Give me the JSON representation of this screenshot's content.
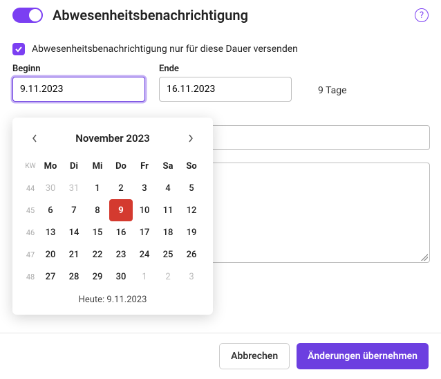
{
  "header": {
    "title": "Abwesenheitsbenachrichtigung"
  },
  "checkbox": {
    "label": "Abwesenheitsbenachrichtigung nur für diese Dauer versenden",
    "checked": true
  },
  "fields": {
    "start_label": "Beginn",
    "start_value": "9.11.2023",
    "end_label": "Ende",
    "end_value": "16.11.2023",
    "duration": "9 Tage"
  },
  "datepicker": {
    "month_year": "November 2023",
    "kw_label": "KW",
    "weekdays": [
      "Mo",
      "Di",
      "Mi",
      "Do",
      "Fr",
      "Sa",
      "So"
    ],
    "weeks": [
      {
        "wk": "44",
        "days": [
          {
            "d": "30",
            "out": true
          },
          {
            "d": "31",
            "out": true
          },
          {
            "d": "1"
          },
          {
            "d": "2"
          },
          {
            "d": "3"
          },
          {
            "d": "4"
          },
          {
            "d": "5"
          }
        ]
      },
      {
        "wk": "45",
        "days": [
          {
            "d": "6"
          },
          {
            "d": "7"
          },
          {
            "d": "8"
          },
          {
            "d": "9",
            "selected": true
          },
          {
            "d": "10"
          },
          {
            "d": "11"
          },
          {
            "d": "12"
          }
        ]
      },
      {
        "wk": "46",
        "days": [
          {
            "d": "13"
          },
          {
            "d": "14"
          },
          {
            "d": "15"
          },
          {
            "d": "16"
          },
          {
            "d": "17"
          },
          {
            "d": "18"
          },
          {
            "d": "19"
          }
        ]
      },
      {
        "wk": "47",
        "days": [
          {
            "d": "20"
          },
          {
            "d": "21"
          },
          {
            "d": "22"
          },
          {
            "d": "23"
          },
          {
            "d": "24"
          },
          {
            "d": "25"
          },
          {
            "d": "26"
          }
        ]
      },
      {
        "wk": "48",
        "days": [
          {
            "d": "27"
          },
          {
            "d": "28"
          },
          {
            "d": "29"
          },
          {
            "d": "30"
          },
          {
            "d": "1",
            "out": true
          },
          {
            "d": "2",
            "out": true
          },
          {
            "d": "3",
            "out": true
          }
        ]
      }
    ],
    "today_label": "Heute: 9.11.2023"
  },
  "footer": {
    "cancel": "Abbrechen",
    "apply": "Änderungen übernehmen"
  }
}
